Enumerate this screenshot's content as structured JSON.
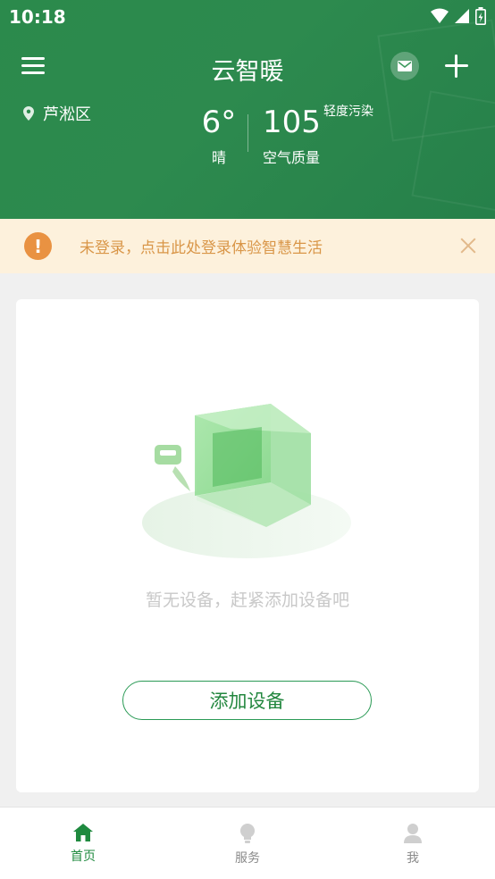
{
  "status_bar": {
    "time": "10:18"
  },
  "header": {
    "title": "云智暖",
    "location": "芦淞区",
    "weather": {
      "temperature": "6°",
      "condition": "晴"
    },
    "air": {
      "aqi": "105",
      "label": "空气质量",
      "level": "轻度污染"
    }
  },
  "notice": {
    "text": "未登录，点击此处登录体验智慧生活",
    "icon": "!"
  },
  "empty_state": {
    "message": "暂无设备，赶紧添加设备吧",
    "button": "添加设备"
  },
  "tabs": [
    {
      "label": "首页",
      "icon": "home-icon",
      "active": true
    },
    {
      "label": "服务",
      "icon": "bulb-icon",
      "active": false
    },
    {
      "label": "我",
      "icon": "user-icon",
      "active": false
    }
  ],
  "colors": {
    "primary": "#2b8a4c",
    "notice_bg": "#fdf1dc",
    "notice_text": "#d99648",
    "warn": "#e99242"
  }
}
